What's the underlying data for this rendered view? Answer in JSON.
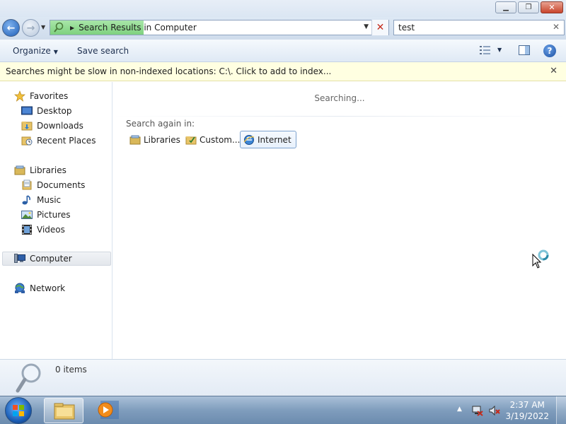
{
  "window": {
    "minimize_glyph": "▁",
    "maximize_glyph": "❐",
    "close_glyph": "✕"
  },
  "address_bar": {
    "breadcrumb": "Search Results in Computer",
    "stop_glyph": "✕",
    "progress_color": "#7fd17f"
  },
  "search": {
    "query": "test",
    "clear_glyph": "✕"
  },
  "toolbar": {
    "organize_label": "Organize",
    "save_search_label": "Save search",
    "help_glyph": "?"
  },
  "infobar": {
    "message": "Searches might be slow in non-indexed locations: C:\\. Click to add to index...",
    "close_glyph": "✕"
  },
  "nav": {
    "favorites": {
      "label": "Favorites",
      "icon": "star-icon"
    },
    "favorites_items": [
      {
        "label": "Desktop",
        "icon": "desktop-icon"
      },
      {
        "label": "Downloads",
        "icon": "downloads-folder-icon"
      },
      {
        "label": "Recent Places",
        "icon": "recent-places-icon"
      }
    ],
    "libraries": {
      "label": "Libraries",
      "icon": "libraries-icon"
    },
    "libraries_items": [
      {
        "label": "Documents",
        "icon": "documents-icon"
      },
      {
        "label": "Music",
        "icon": "music-icon"
      },
      {
        "label": "Pictures",
        "icon": "pictures-icon"
      },
      {
        "label": "Videos",
        "icon": "videos-icon"
      }
    ],
    "computer": {
      "label": "Computer",
      "icon": "computer-icon",
      "selected": true
    },
    "network": {
      "label": "Network",
      "icon": "network-icon"
    }
  },
  "content": {
    "status": "Searching...",
    "search_again_label": "Search again in:",
    "search_again_options": [
      {
        "label": "Libraries",
        "icon": "libraries-icon"
      },
      {
        "label": "Custom...",
        "icon": "custom-folder-icon"
      },
      {
        "label": "Internet",
        "icon": "internet-explorer-icon"
      }
    ]
  },
  "details": {
    "item_count": "0 items"
  },
  "taskbar": {
    "time": "2:37 AM",
    "date": "3/19/2022",
    "tray_arrow": "▲"
  }
}
